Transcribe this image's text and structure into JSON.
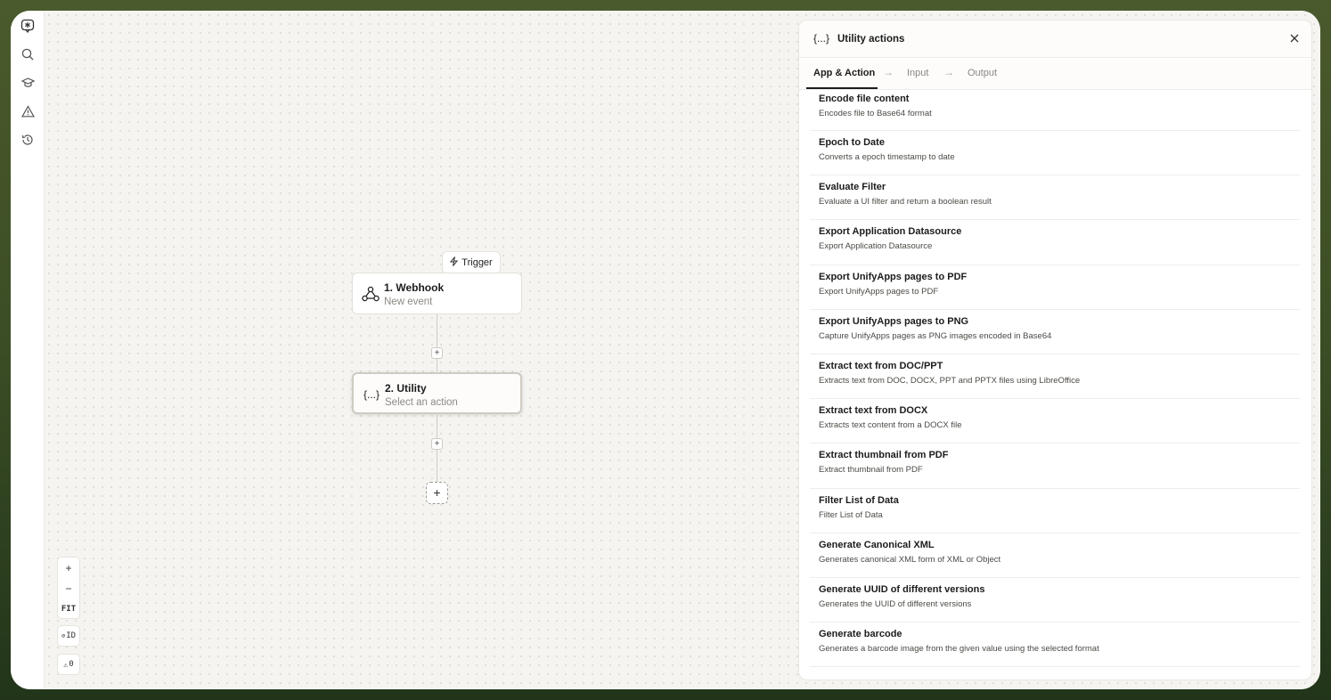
{
  "canvas": {
    "trigger_label": "Trigger",
    "nodes": [
      {
        "title": "1. Webhook",
        "subtitle": "New event"
      },
      {
        "title": "2. Utility",
        "subtitle": "Select an action",
        "icon_text": "{...}"
      }
    ],
    "zoom": {
      "plus": "+",
      "minus": "−",
      "fit": "FIT"
    },
    "id_toggle": "ID",
    "warnings_count": "0"
  },
  "panel": {
    "icon_text": "{...}",
    "title": "Utility actions",
    "tabs": [
      "App & Action",
      "Input",
      "Output"
    ],
    "actions": [
      {
        "title": "Encode file content",
        "desc": "Encodes file to Base64 format"
      },
      {
        "title": "Epoch to Date",
        "desc": "Converts a epoch timestamp to date"
      },
      {
        "title": "Evaluate Filter",
        "desc": "Evaluate a UI filter and return a boolean result"
      },
      {
        "title": "Export Application Datasource",
        "desc": "Export Application Datasource"
      },
      {
        "title": "Export UnifyApps pages to PDF",
        "desc": "Export UnifyApps pages to PDF"
      },
      {
        "title": "Export UnifyApps pages to PNG",
        "desc": "Capture UnifyApps pages as PNG images encoded in Base64"
      },
      {
        "title": "Extract text from DOC/PPT",
        "desc": "Extracts text from DOC, DOCX, PPT and PPTX files using LibreOffice"
      },
      {
        "title": "Extract text from DOCX",
        "desc": "Extracts text content from a DOCX file"
      },
      {
        "title": "Extract thumbnail from PDF",
        "desc": "Extract thumbnail from PDF"
      },
      {
        "title": "Filter List of Data",
        "desc": "Filter List of Data"
      },
      {
        "title": "Generate Canonical XML",
        "desc": "Generates canonical XML form of XML or Object"
      },
      {
        "title": "Generate UUID of different versions",
        "desc": "Generates the UUID of different versions"
      },
      {
        "title": "Generate barcode",
        "desc": "Generates a barcode image from the given value using the selected format"
      }
    ]
  }
}
